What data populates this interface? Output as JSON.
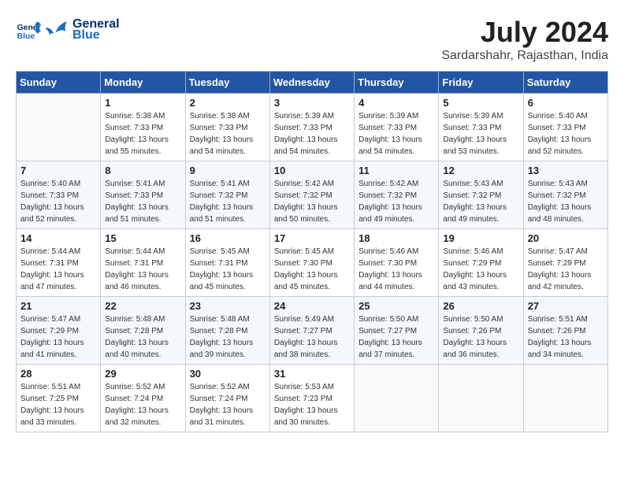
{
  "header": {
    "logo_line1": "General",
    "logo_line2": "Blue",
    "month_year": "July 2024",
    "location": "Sardarshahr, Rajasthan, India"
  },
  "days_of_week": [
    "Sunday",
    "Monday",
    "Tuesday",
    "Wednesday",
    "Thursday",
    "Friday",
    "Saturday"
  ],
  "weeks": [
    [
      {
        "num": "",
        "info": ""
      },
      {
        "num": "1",
        "info": "Sunrise: 5:38 AM\nSunset: 7:33 PM\nDaylight: 13 hours\nand 55 minutes."
      },
      {
        "num": "2",
        "info": "Sunrise: 5:38 AM\nSunset: 7:33 PM\nDaylight: 13 hours\nand 54 minutes."
      },
      {
        "num": "3",
        "info": "Sunrise: 5:39 AM\nSunset: 7:33 PM\nDaylight: 13 hours\nand 54 minutes."
      },
      {
        "num": "4",
        "info": "Sunrise: 5:39 AM\nSunset: 7:33 PM\nDaylight: 13 hours\nand 54 minutes."
      },
      {
        "num": "5",
        "info": "Sunrise: 5:39 AM\nSunset: 7:33 PM\nDaylight: 13 hours\nand 53 minutes."
      },
      {
        "num": "6",
        "info": "Sunrise: 5:40 AM\nSunset: 7:33 PM\nDaylight: 13 hours\nand 52 minutes."
      }
    ],
    [
      {
        "num": "7",
        "info": "Sunrise: 5:40 AM\nSunset: 7:33 PM\nDaylight: 13 hours\nand 52 minutes."
      },
      {
        "num": "8",
        "info": "Sunrise: 5:41 AM\nSunset: 7:33 PM\nDaylight: 13 hours\nand 51 minutes."
      },
      {
        "num": "9",
        "info": "Sunrise: 5:41 AM\nSunset: 7:32 PM\nDaylight: 13 hours\nand 51 minutes."
      },
      {
        "num": "10",
        "info": "Sunrise: 5:42 AM\nSunset: 7:32 PM\nDaylight: 13 hours\nand 50 minutes."
      },
      {
        "num": "11",
        "info": "Sunrise: 5:42 AM\nSunset: 7:32 PM\nDaylight: 13 hours\nand 49 minutes."
      },
      {
        "num": "12",
        "info": "Sunrise: 5:43 AM\nSunset: 7:32 PM\nDaylight: 13 hours\nand 49 minutes."
      },
      {
        "num": "13",
        "info": "Sunrise: 5:43 AM\nSunset: 7:32 PM\nDaylight: 13 hours\nand 48 minutes."
      }
    ],
    [
      {
        "num": "14",
        "info": "Sunrise: 5:44 AM\nSunset: 7:31 PM\nDaylight: 13 hours\nand 47 minutes."
      },
      {
        "num": "15",
        "info": "Sunrise: 5:44 AM\nSunset: 7:31 PM\nDaylight: 13 hours\nand 46 minutes."
      },
      {
        "num": "16",
        "info": "Sunrise: 5:45 AM\nSunset: 7:31 PM\nDaylight: 13 hours\nand 45 minutes."
      },
      {
        "num": "17",
        "info": "Sunrise: 5:45 AM\nSunset: 7:30 PM\nDaylight: 13 hours\nand 45 minutes."
      },
      {
        "num": "18",
        "info": "Sunrise: 5:46 AM\nSunset: 7:30 PM\nDaylight: 13 hours\nand 44 minutes."
      },
      {
        "num": "19",
        "info": "Sunrise: 5:46 AM\nSunset: 7:29 PM\nDaylight: 13 hours\nand 43 minutes."
      },
      {
        "num": "20",
        "info": "Sunrise: 5:47 AM\nSunset: 7:29 PM\nDaylight: 13 hours\nand 42 minutes."
      }
    ],
    [
      {
        "num": "21",
        "info": "Sunrise: 5:47 AM\nSunset: 7:29 PM\nDaylight: 13 hours\nand 41 minutes."
      },
      {
        "num": "22",
        "info": "Sunrise: 5:48 AM\nSunset: 7:28 PM\nDaylight: 13 hours\nand 40 minutes."
      },
      {
        "num": "23",
        "info": "Sunrise: 5:48 AM\nSunset: 7:28 PM\nDaylight: 13 hours\nand 39 minutes."
      },
      {
        "num": "24",
        "info": "Sunrise: 5:49 AM\nSunset: 7:27 PM\nDaylight: 13 hours\nand 38 minutes."
      },
      {
        "num": "25",
        "info": "Sunrise: 5:50 AM\nSunset: 7:27 PM\nDaylight: 13 hours\nand 37 minutes."
      },
      {
        "num": "26",
        "info": "Sunrise: 5:50 AM\nSunset: 7:26 PM\nDaylight: 13 hours\nand 36 minutes."
      },
      {
        "num": "27",
        "info": "Sunrise: 5:51 AM\nSunset: 7:26 PM\nDaylight: 13 hours\nand 34 minutes."
      }
    ],
    [
      {
        "num": "28",
        "info": "Sunrise: 5:51 AM\nSunset: 7:25 PM\nDaylight: 13 hours\nand 33 minutes."
      },
      {
        "num": "29",
        "info": "Sunrise: 5:52 AM\nSunset: 7:24 PM\nDaylight: 13 hours\nand 32 minutes."
      },
      {
        "num": "30",
        "info": "Sunrise: 5:52 AM\nSunset: 7:24 PM\nDaylight: 13 hours\nand 31 minutes."
      },
      {
        "num": "31",
        "info": "Sunrise: 5:53 AM\nSunset: 7:23 PM\nDaylight: 13 hours\nand 30 minutes."
      },
      {
        "num": "",
        "info": ""
      },
      {
        "num": "",
        "info": ""
      },
      {
        "num": "",
        "info": ""
      }
    ]
  ]
}
